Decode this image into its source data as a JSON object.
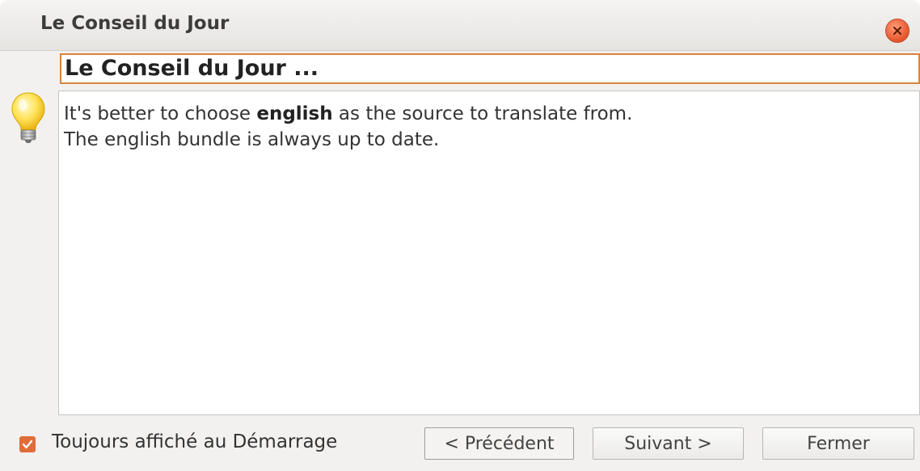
{
  "window": {
    "title": "Le Conseil du Jour"
  },
  "tip": {
    "heading": "Le Conseil du Jour ...",
    "line1_before": "It's better to choose ",
    "line1_bold": "english",
    "line1_after": " as the source to translate from.",
    "line2": "The english bundle is always up to date."
  },
  "footer": {
    "show_on_startup_label": "Toujours affiché au Démarrage",
    "show_on_startup_checked": true,
    "prev_label": "< Précédent",
    "next_label": "Suivant >",
    "close_label": "Fermer"
  },
  "icons": {
    "close": "close-icon",
    "bulb": "lightbulb-icon",
    "check": "check-icon"
  },
  "colors": {
    "accent": "#e06c38",
    "close_button": "#ea5d35",
    "heading_border": "#d9833c"
  }
}
